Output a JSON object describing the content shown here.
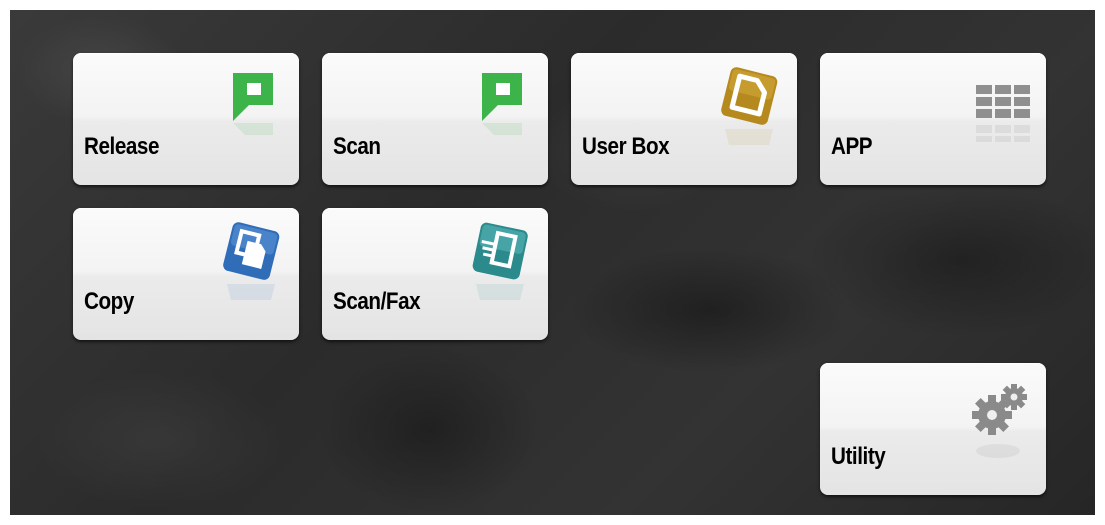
{
  "tiles": [
    {
      "label": "Release",
      "icon": "release-icon",
      "color": "#3cb44a"
    },
    {
      "label": "Scan",
      "icon": "scan-icon",
      "color": "#3cb44a"
    },
    {
      "label": "User Box",
      "icon": "user-box-icon",
      "color": "#b5891e"
    },
    {
      "label": "APP",
      "icon": "app-grid-icon",
      "color": "#8a8a8a"
    },
    {
      "label": "Copy",
      "icon": "copy-icon",
      "color": "#2f6db8"
    },
    {
      "label": "Scan/Fax",
      "icon": "scan-fax-icon",
      "color": "#2a8a8c"
    },
    {
      "label": "Utility",
      "icon": "gear-icon",
      "color": "#8a8a8a"
    }
  ]
}
